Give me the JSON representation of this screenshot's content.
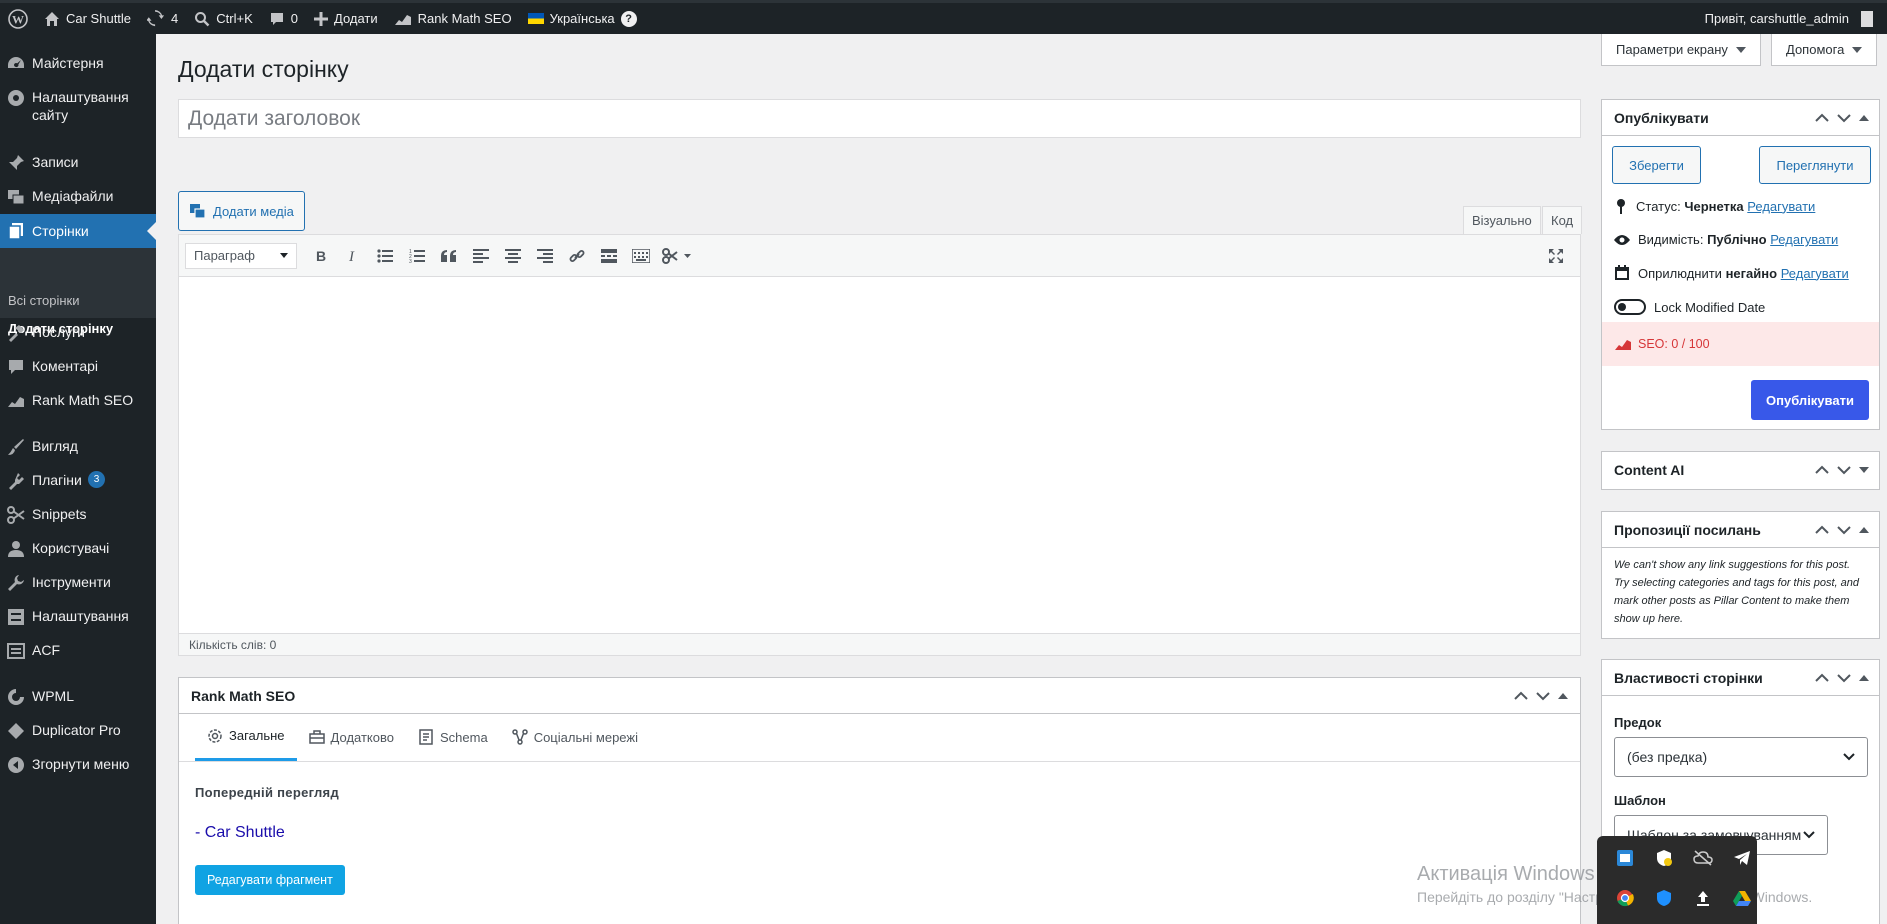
{
  "adminbar": {
    "site_name": "Car Shuttle",
    "updates_count": "4",
    "shortcut": "Ctrl+K",
    "comments_count": "0",
    "add_new": "Додати",
    "rank_math": "Rank Math SEO",
    "language": "Українська",
    "greeting": "Привіт, carshuttle_admin"
  },
  "sidebar": {
    "items": [
      {
        "label": "Майстерня",
        "icon": "dashboard-icon"
      },
      {
        "label": "Налаштування сайту",
        "icon": "site-settings-icon"
      },
      {
        "label": "Записи",
        "icon": "pin-icon"
      },
      {
        "label": "Медіафайли",
        "icon": "media-icon"
      },
      {
        "label": "Сторінки",
        "icon": "pages-icon"
      },
      {
        "label": "Послуги",
        "icon": "hammer-icon"
      },
      {
        "label": "Коментарі",
        "icon": "comment-icon"
      },
      {
        "label": "Rank Math SEO",
        "icon": "rank-math-icon"
      },
      {
        "label": "Вигляд",
        "icon": "brush-icon"
      },
      {
        "label": "Плагіни",
        "icon": "plugin-icon",
        "badge": "3"
      },
      {
        "label": "Snippets",
        "icon": "scissors-icon"
      },
      {
        "label": "Користувачі",
        "icon": "user-icon"
      },
      {
        "label": "Інструменти",
        "icon": "wrench-icon"
      },
      {
        "label": "Налаштування",
        "icon": "settings-icon"
      },
      {
        "label": "ACF",
        "icon": "acf-icon"
      },
      {
        "label": "WPML",
        "icon": "wpml-icon"
      },
      {
        "label": "Duplicator Pro",
        "icon": "duplicator-icon"
      },
      {
        "label": "Згорнути меню",
        "icon": "collapse-icon"
      }
    ],
    "submenu": [
      "Всі сторінки",
      "Додати сторінку"
    ]
  },
  "header": {
    "title": "Додати сторінку",
    "screen_options": "Параметри екрану",
    "help": "Допомога"
  },
  "editor": {
    "title_placeholder": "Додати заголовок",
    "add_media": "Додати медіа",
    "tab_visual": "Візуально",
    "tab_code": "Код",
    "format_select": "Параграф",
    "word_count": "Кількість слів: 0"
  },
  "rank_math": {
    "title": "Rank Math SEO",
    "tabs": [
      "Загальне",
      "Додатково",
      "Schema",
      "Соціальні мережі"
    ],
    "preview_label": "Попередній перегляд",
    "preview_title": "- Car Shuttle",
    "edit_snippet": "Редагувати фрагмент"
  },
  "publish": {
    "title": "Опублікувати",
    "save": "Зберегти",
    "preview": "Переглянути",
    "status_label": "Статус:",
    "status_value": "Чернетка",
    "visibility_label": "Видимість:",
    "visibility_value": "Публічно",
    "publish_label": "Оприлюднити",
    "publish_value": "негайно",
    "edit": "Редагувати",
    "lock_modified": "Lock Modified Date",
    "seo_score": "SEO: 0 / 100",
    "publish_button": "Опублікувати"
  },
  "content_ai": {
    "title": "Content AI"
  },
  "link_suggestions": {
    "title": "Пропозиції посилань",
    "note": "We can't show any link suggestions for this post. Try selecting categories and tags for this post, and mark other posts as Pillar Content to make them show up here."
  },
  "page_attributes": {
    "title": "Властивості сторінки",
    "parent_label": "Предок",
    "parent_value": "(без предка)",
    "template_label": "Шаблон",
    "template_value": "Шаблон за замовчуванням"
  },
  "watermark": {
    "line1": "Активація Windows",
    "line2": "Перейдіть до розділу \"Настройки\", щоб активувати Windows."
  },
  "colors": {
    "accent": "#2271b1",
    "sidebar_bg": "#1d2327",
    "seo_bad": "#d63638",
    "publish_btn": "#3858e9"
  }
}
